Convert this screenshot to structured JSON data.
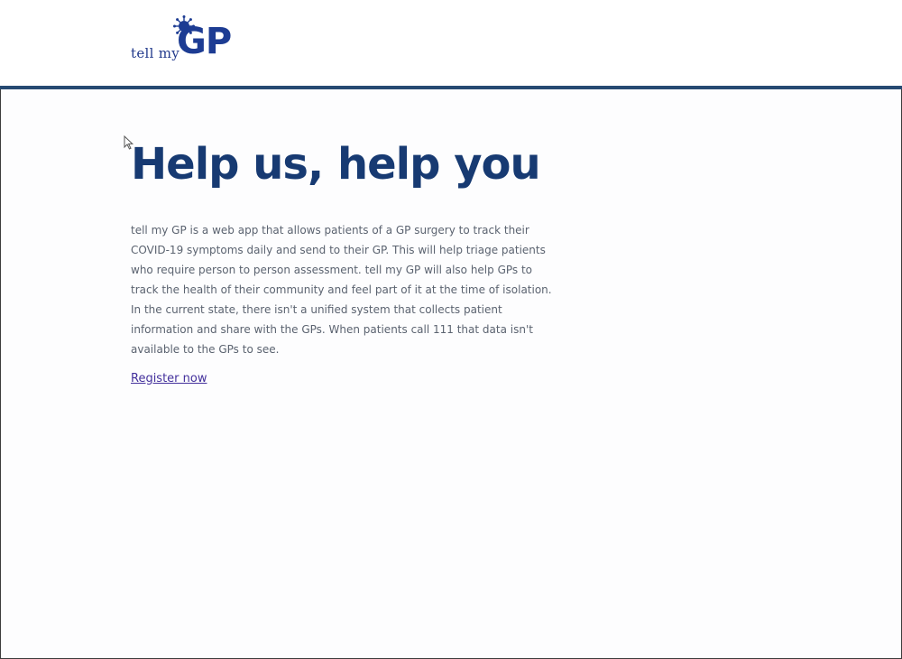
{
  "header": {
    "logo": {
      "small_text": "tell my",
      "big_text": "GP",
      "accent_color": "#1d3c93"
    },
    "rule_color": "#264a72"
  },
  "main": {
    "headline": "Help us, help you",
    "intro": "tell my GP is a web app that allows patients of a GP surgery to track their COVID-19 symptoms daily and send to their GP. This will help triage patients who require person to person assessment. tell my GP will also help GPs to track the health of their community and feel part of it at the time of isolation. In the current state, there isn't a unified system that collects patient information and share with the GPs. When patients call 111 that data isn't available to the GPs to see.",
    "register_link": "Register now"
  },
  "icons": {
    "logo_mark": "virus-icon",
    "pointer": "mouse-cursor-icon"
  }
}
